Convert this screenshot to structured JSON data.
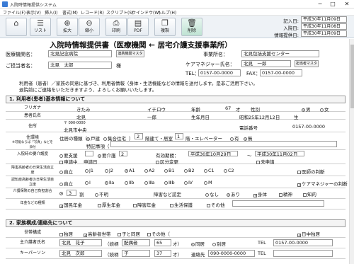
{
  "window": {
    "title": "入院時情報提供システム"
  },
  "menu": [
    "ファイル(F)",
    "表示(V)",
    "挿入(I)",
    "書式(M)",
    "レコード(R)",
    "スクリプト(S)",
    "ウインドウ(W)",
    "ヘルプ(H)"
  ],
  "toolbar": {
    "home": "",
    "list": "リスト",
    "zoom_in": "拡大",
    "zoom_out": "縮小",
    "print": "印刷",
    "pdf": "PDF",
    "duplicate": "複製",
    "delete": "削除"
  },
  "header": {
    "entry_date_label": "記入日:",
    "entry_date": "平成30年11月09日",
    "hosp_date_label": "入院日:",
    "hosp_date": "平成30年11月08日",
    "info_date_label": "情報提供日:",
    "info_date": "平成30年11月09日"
  },
  "title": "入院時情報提供書（医療機関 ← 居宅介護支援事業所）",
  "form": {
    "hospital_label": "医療機関名：",
    "hospital": "北見記念病院",
    "hospital_btn": "連携機関マスタ",
    "contact_label": "ご担当者名：",
    "contact": "北見　太郎",
    "sama": "様",
    "office_label": "事業所名：",
    "office": "北見包括支援センター",
    "cm_label": "ケアマネジャー氏名：",
    "cm": "北見　一郎",
    "cm_btn": "担当者マスタ",
    "tel_label": "TEL：",
    "tel": "0157-00-0000",
    "fax_label": "FAX：",
    "fax": "0157-00-0000"
  },
  "notice": [
    "利用者（患者）／家族の同意に基づき、利用者情報（身体・生活機能などの情報を送付します。是非ご活用下さい。",
    "退院前にご連絡をいただきますよう、よろしくお願いいたします。"
  ],
  "section1": "1. 利用者(患者)基本情報について",
  "basic": {
    "furigana_label": "フリガナ",
    "furi_sei": "きたみ",
    "furi_mei": "イチロウ",
    "age_label": "年齢",
    "age": "67",
    "age_unit": "才",
    "sex_label": "性別",
    "male": "男",
    "female": "女",
    "name_label": "患者氏名",
    "sei": "北見",
    "mei": "一郎",
    "birth_label": "生年月日",
    "birth": "昭和25年12月12日",
    "birth_unit": "生",
    "address_label": "住所",
    "zip": "〒 090-0000",
    "address": "北見市中央",
    "phone_label": "電話番号",
    "phone": "0157-00-0000",
    "residence_label": "住環境",
    "residence_sub": "※可能ならば「写真」などを添付",
    "house": "住居の種類（",
    "kodate": "戸建",
    "shugo": "集合住宅",
    "floor_pre": "）",
    "floor": "2",
    "floor_txt": "階建て・居室",
    "room_floor": "1",
    "room_txt": "階・エレベーター",
    "ev_yes": "有",
    "ev_no": "無",
    "special_label": "特記事項（",
    "care_label": "入院時の要介護度",
    "care_support": "要支援",
    "support_lv": "",
    "care_need": "要介護",
    "need_lv": "2",
    "valid_label": "有効期間：",
    "valid_from": "平成30年10月29日",
    "valid_to": "平成30年11月02日",
    "applying": "申請中",
    "apply_date": "申請日",
    "kubun": "区分変更",
    "mishinsei": "未申請",
    "dementia_label": "障害高齢者の日常生活自立度",
    "lv": [
      "自立",
      "J1",
      "J2",
      "A1",
      "A2",
      "B1",
      "B2",
      "C1",
      "C2"
    ],
    "doctor": "医師の判断",
    "ninchi_label": "認知症高齢者の日常生活自立度",
    "ninchi": [
      "自立",
      "Ⅰ",
      "Ⅱa",
      "Ⅱb",
      "Ⅲa",
      "Ⅲb",
      "Ⅳ",
      "M"
    ],
    "cm_judge": "ケアマネジャーの判断",
    "burden_label": "介護保険の自己負担割合",
    "burden": "3",
    "burden_unit": "割",
    "unknown": "不明",
    "disability_label": "障害など認定",
    "none": "なし",
    "yes": "あり",
    "body": "身体",
    "mental": "精神",
    "intel": "知的",
    "pension_label": "年金などの種類",
    "pension": [
      "国民年金",
      "厚生年金",
      "障害年金",
      "生活保護",
      "その他"
    ]
  },
  "section2": "2. 家族構成/連絡先について",
  "family": {
    "household_label": "世帯構成",
    "alone": "独居",
    "elderly": "高齢者世帯",
    "child": "子と同居",
    "other": "その他（",
    "daytime": "日中独居",
    "keyperson_label": "主介護者氏名",
    "kp_name": "北見　花子",
    "rel_label": "（続柄",
    "rel": "配偶者",
    "age_label2": "才）",
    "kp_age": "65",
    "cohab": "同居",
    "sep": "別居",
    "tel_label": "TEL",
    "kp_tel": "0157-00-0000",
    "key_label": "キーパーソン",
    "key_name": "北見　次郎",
    "key_rel": "子",
    "key_age": "37",
    "contact_label": "連絡先",
    "key_tel": "090-0000-0000",
    "tel2": "TEL"
  }
}
